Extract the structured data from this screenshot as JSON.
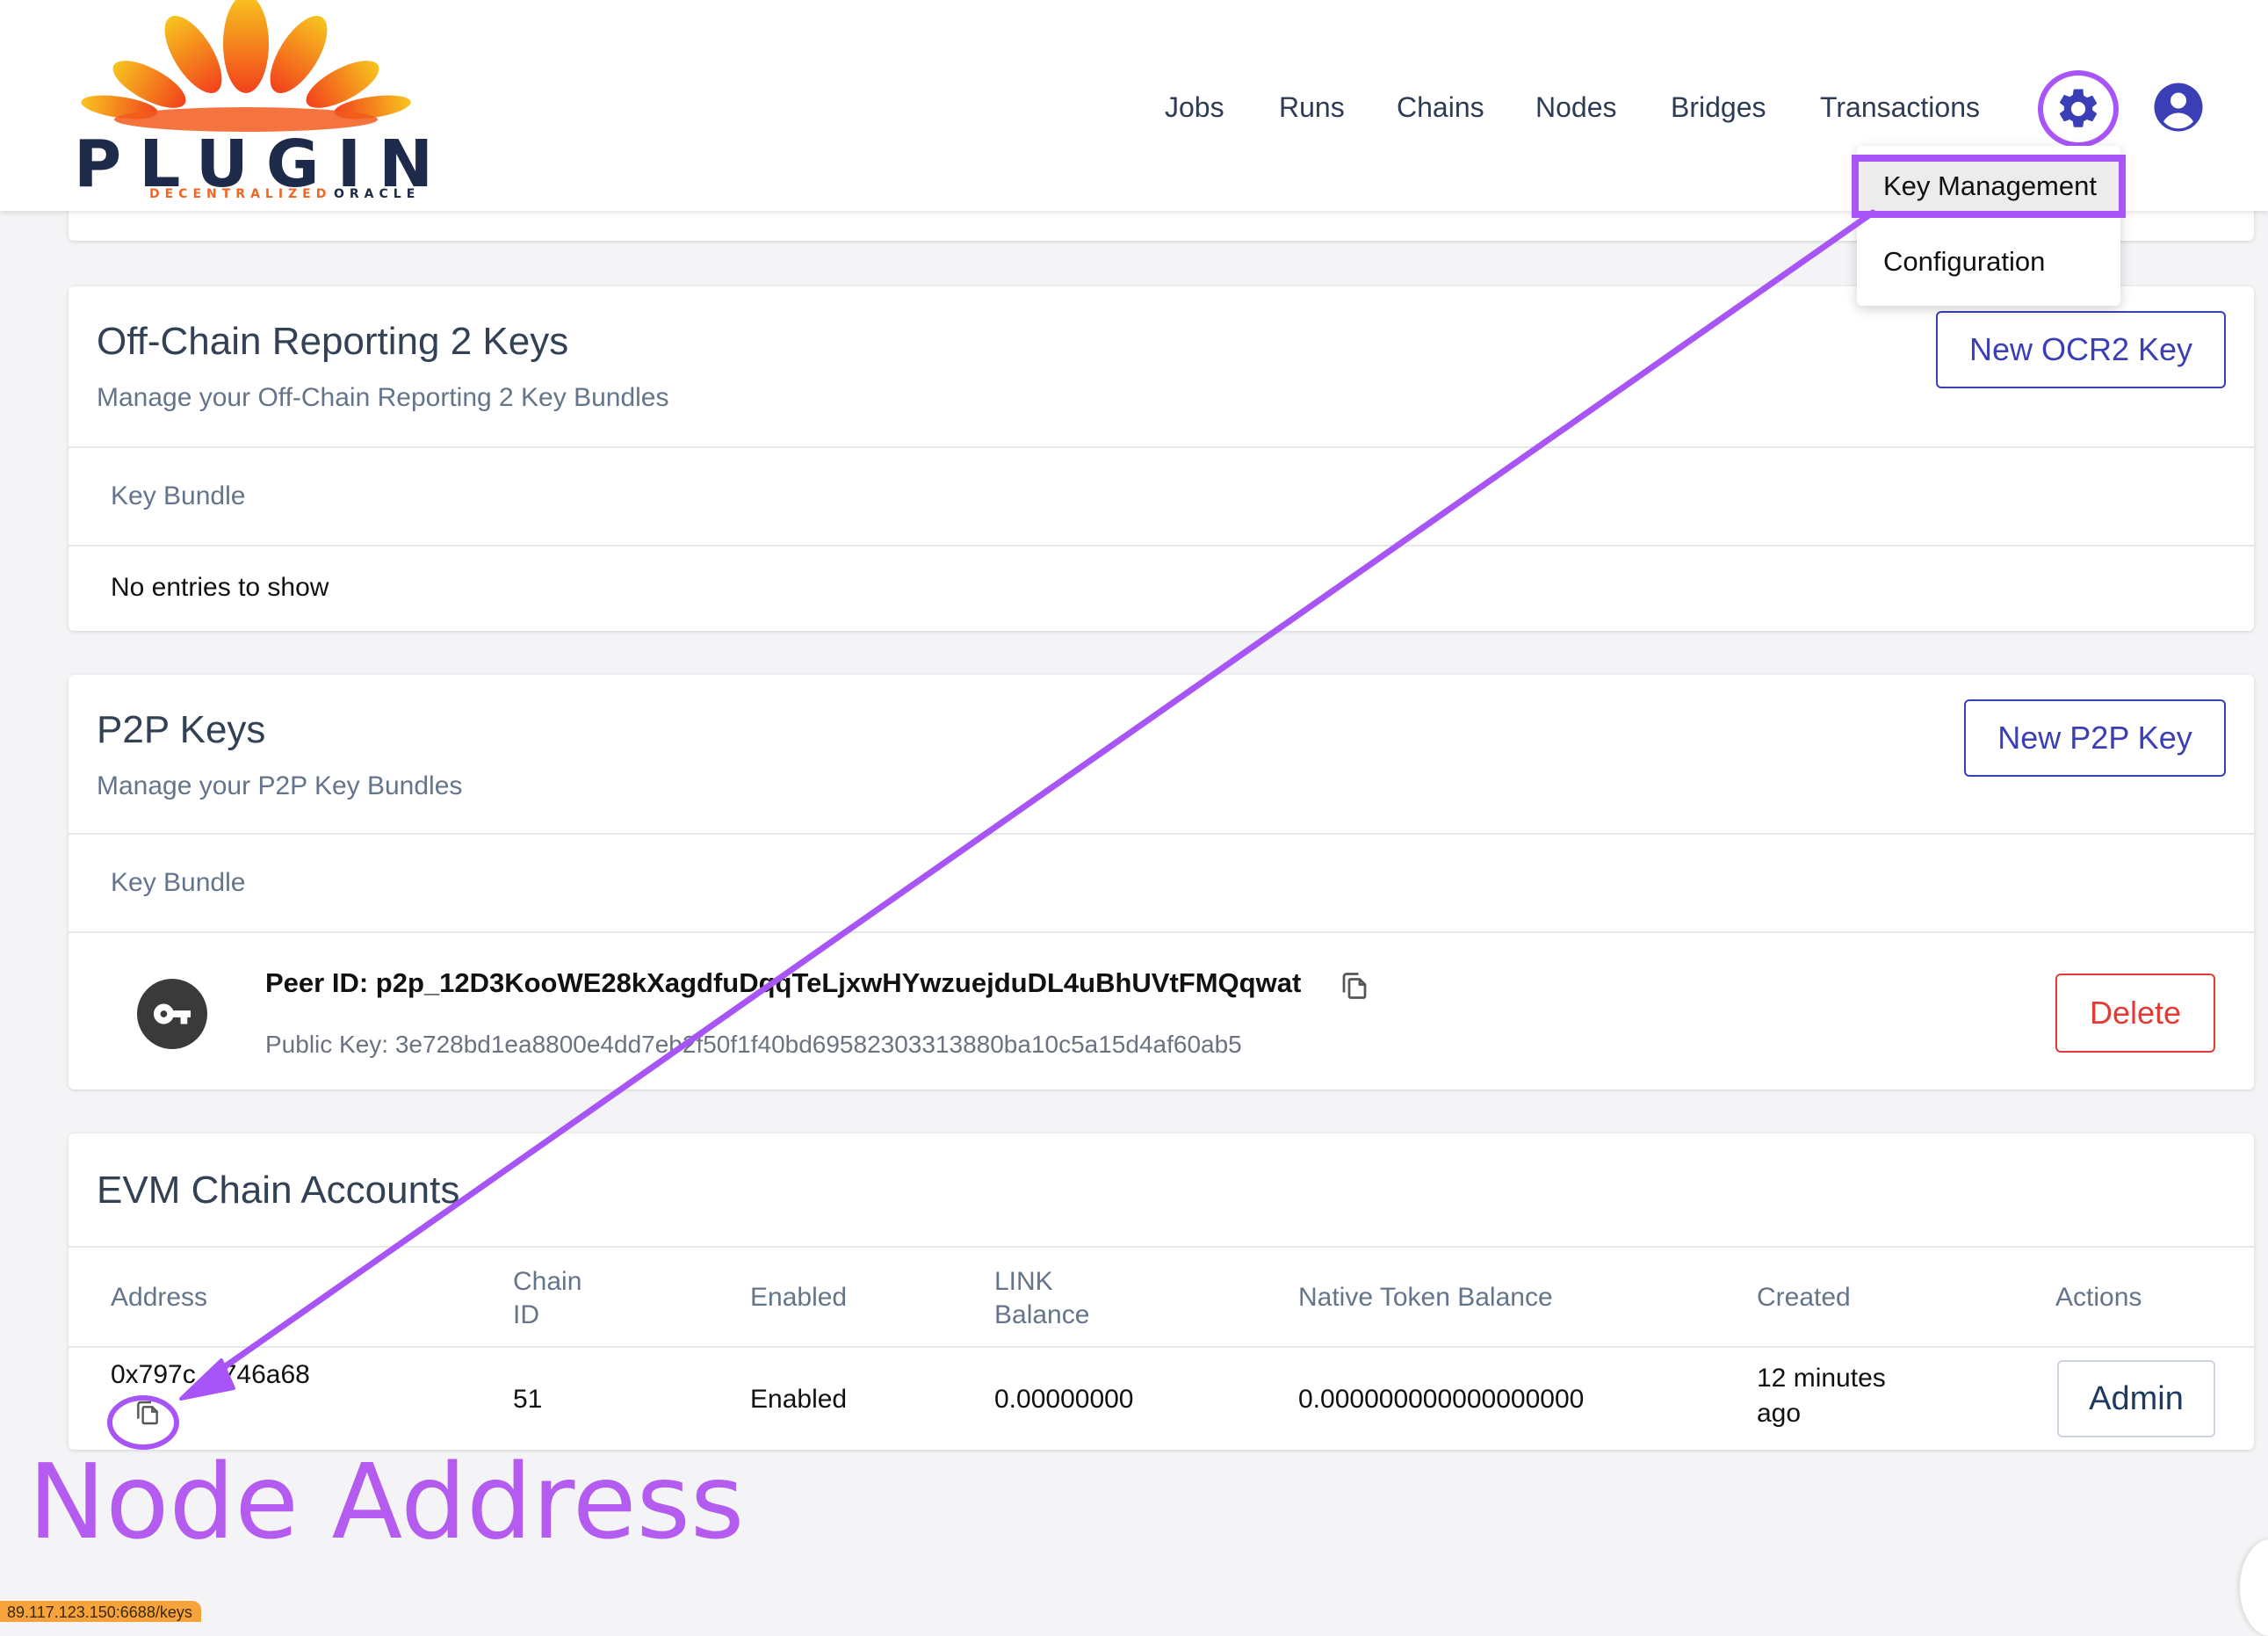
{
  "brand": {
    "name": "PLUGIN",
    "tagline_left": "DECENTRALIZED",
    "tagline_right": "ORACLE",
    "orange": "#f26522",
    "navy": "#1e2a4a"
  },
  "nav": {
    "items": [
      "Jobs",
      "Runs",
      "Chains",
      "Nodes",
      "Bridges",
      "Transactions"
    ],
    "settings_icon": "gear-icon",
    "account_icon": "user-circle-icon"
  },
  "settings_menu": {
    "items": [
      "Key Management",
      "Configuration"
    ],
    "highlighted": "Key Management"
  },
  "ocr2": {
    "title": "Off-Chain Reporting 2 Keys",
    "subtitle": "Manage your Off-Chain Reporting 2 Key Bundles",
    "button": "New OCR2 Key",
    "column": "Key Bundle",
    "empty": "No entries to show"
  },
  "p2p": {
    "title": "P2P Keys",
    "subtitle": "Manage your P2P Key Bundles",
    "button": "New P2P Key",
    "column": "Key Bundle",
    "row": {
      "peer_id": "Peer ID: p2p_12D3KooWE28kXagdfuDqqTeLjxwHYwzuejduDL4uBhUVtFMQqwat",
      "public_key": "Public Key: 3e728bd1ea8800e4dd7eb2f50f1f40bd69582303313880ba10c5a15d4af60ab5",
      "delete": "Delete"
    }
  },
  "evm": {
    "title": "EVM Chain Accounts",
    "headers": {
      "address": "Address",
      "chain_id_1": "Chain",
      "chain_id_2": "ID",
      "enabled": "Enabled",
      "link_1": "LINK",
      "link_2": "Balance",
      "native": "Native Token Balance",
      "created": "Created",
      "actions": "Actions"
    },
    "row": {
      "address": "0x797c…746a68",
      "chain_id": "51",
      "enabled": "Enabled",
      "link_balance": "0.00000000",
      "native_balance": "0.000000000000000000",
      "created_1": "12 minutes",
      "created_2": "ago",
      "action": "Admin"
    }
  },
  "annotation": {
    "label": "Node Address",
    "color": "#a855f7"
  },
  "status_url": "89.117.123.150:6688/keys"
}
